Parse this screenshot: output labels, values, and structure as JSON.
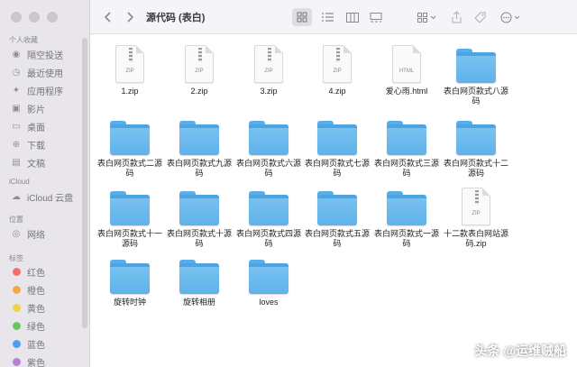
{
  "window": {
    "title": "源代码 (表白)"
  },
  "sidebar": {
    "favorites_header": "个人收藏",
    "favorites": [
      {
        "label": "隔空投送",
        "icon": "airdrop-icon"
      },
      {
        "label": "最近使用",
        "icon": "clock-icon"
      },
      {
        "label": "应用程序",
        "icon": "applications-icon"
      },
      {
        "label": "影片",
        "icon": "movies-icon"
      },
      {
        "label": "桌面",
        "icon": "desktop-icon"
      },
      {
        "label": "下载",
        "icon": "download-icon"
      },
      {
        "label": "文稿",
        "icon": "document-icon"
      }
    ],
    "icloud_header": "iCloud",
    "icloud": [
      {
        "label": "iCloud 云盘",
        "icon": "cloud-icon"
      }
    ],
    "locations_header": "位置",
    "locations": [
      {
        "label": "网络",
        "icon": "network-icon"
      }
    ],
    "tags_header": "标签",
    "tags": [
      {
        "label": "红色",
        "color": "#f2706a"
      },
      {
        "label": "橙色",
        "color": "#f5a84a"
      },
      {
        "label": "黄色",
        "color": "#f4cf4c"
      },
      {
        "label": "绿色",
        "color": "#6cc564"
      },
      {
        "label": "蓝色",
        "color": "#4f9ff0"
      },
      {
        "label": "紫色",
        "color": "#b781d6"
      }
    ]
  },
  "toolbar": {
    "back_icon": "chevron-left-icon",
    "forward_icon": "chevron-right-icon",
    "views": [
      "icon-view-icon",
      "list-view-icon",
      "column-view-icon",
      "gallery-view-icon"
    ],
    "group_icon": "group-icon",
    "share_icon": "share-icon",
    "tag_icon": "tag-icon",
    "more_icon": "more-icon"
  },
  "files": [
    {
      "name": "1.zip",
      "kind": "zip",
      "ext": "ZIP"
    },
    {
      "name": "2.zip",
      "kind": "zip",
      "ext": "ZIP"
    },
    {
      "name": "3.zip",
      "kind": "zip",
      "ext": "ZIP"
    },
    {
      "name": "4.zip",
      "kind": "zip",
      "ext": "ZIP"
    },
    {
      "name": "爱心雨.html",
      "kind": "doc",
      "ext": "HTML"
    },
    {
      "name": "表白网页款式八源码",
      "kind": "folder"
    },
    {
      "name": "表白网页款式二源码",
      "kind": "folder"
    },
    {
      "name": "表白网页款式九源码",
      "kind": "folder"
    },
    {
      "name": "表白网页款式六源码",
      "kind": "folder"
    },
    {
      "name": "表白网页款式七源码",
      "kind": "folder"
    },
    {
      "name": "表白网页款式三源码",
      "kind": "folder"
    },
    {
      "name": "表白网页款式十二源码",
      "kind": "folder"
    },
    {
      "name": "表白网页款式十一源码",
      "kind": "folder"
    },
    {
      "name": "表白网页款式十源码",
      "kind": "folder"
    },
    {
      "name": "表白网页款式四源码",
      "kind": "folder"
    },
    {
      "name": "表白网页款式五源码",
      "kind": "folder"
    },
    {
      "name": "表白网页款式一源码",
      "kind": "folder"
    },
    {
      "name": "十二款表白网站源码.zip",
      "kind": "zip",
      "ext": "ZIP"
    },
    {
      "name": "旋转时钟",
      "kind": "folder"
    },
    {
      "name": "旋转相册",
      "kind": "folder"
    },
    {
      "name": "loves",
      "kind": "folder"
    }
  ],
  "watermark": "头条 @运维贼船",
  "colors": {
    "folder": "#6bb9ee",
    "sidebar_bg": "#e8e6ea",
    "accent": "#4f9ff0"
  }
}
